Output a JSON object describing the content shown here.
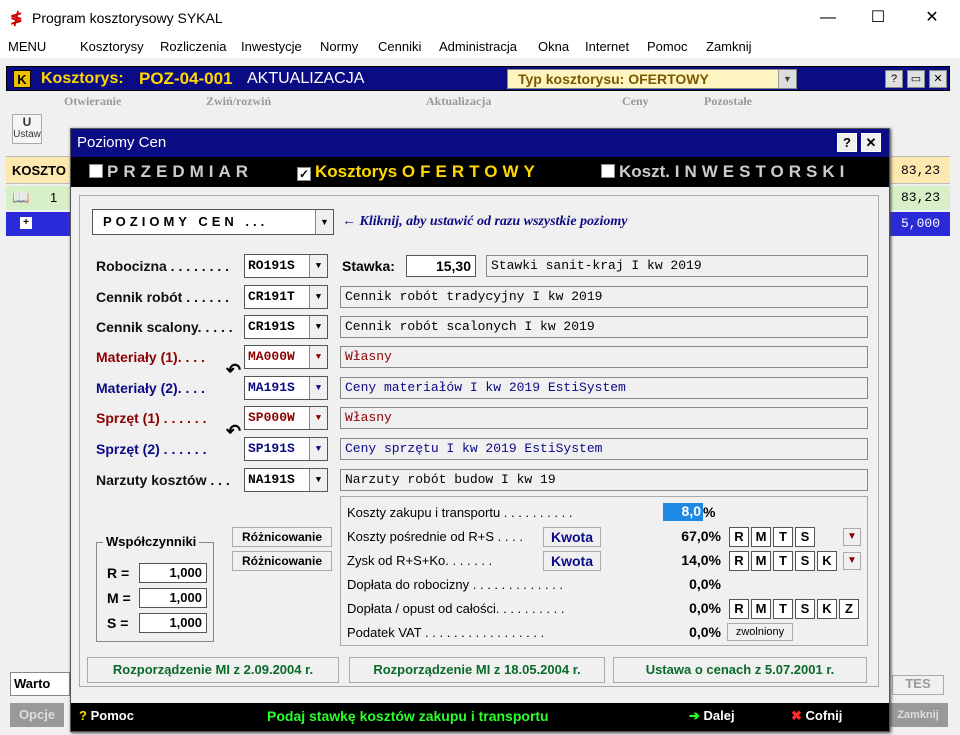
{
  "app": {
    "title": "Program kosztorysowy SYKAL",
    "min": "—",
    "max": "☐",
    "close": "✕"
  },
  "menu": [
    "MENU",
    "Kosztorysy",
    "Rozliczenia",
    "Inwestycje",
    "Normy",
    "Cenniki",
    "Administracja",
    "Okna",
    "Internet",
    "Pomoc",
    "Zamknij"
  ],
  "kbar": {
    "k": "K",
    "label": "Kosztorys:",
    "code": "POZ-04-001",
    "status": "AKTUALIZACJA",
    "typ": "Typ kosztorysu:  OFERTOWY"
  },
  "toolbar": {
    "groups": [
      "Otwieranie",
      "Zwiń/rozwiń",
      "Aktualizacja",
      "Ceny",
      "Pozostałe"
    ],
    "ustaw": "U",
    "ustaw_label": "Ustaw"
  },
  "bg": {
    "koszto": "KOSZTO",
    "sum1": "83,23",
    "row1_num": "1",
    "sum2": "83,23",
    "sum3": "5,000",
    "warto": "Warto",
    "tes": "TES",
    "opcje": "Opcje",
    "zamknij": "Zamknij"
  },
  "dialog": {
    "title": "Poziomy Cen",
    "help": "?",
    "close": "✕",
    "modes": {
      "m1": "PRZEDMIAR",
      "m2a": "Kosztorys",
      "m2b": "OFERTOWY",
      "m3a": "Koszt.",
      "m3b": "INWESTORSKI"
    },
    "poziomy": "POZIOMY CEN ...",
    "hint": "← Kliknij, aby ustawić od razu wszystkie poziomy",
    "stawka_label": "Stawka:",
    "stawka_value": "15,30",
    "stawka_desc": "Stawki sanit-kraj   I kw 2019",
    "rows": [
      {
        "label": "Robocizna . . . . . . . .",
        "code": "RO191S",
        "desc": ""
      },
      {
        "label": "Cennik robót . . . . . .",
        "code": "CR191T",
        "desc": "Cennik robót tradycyjny I kw 2019"
      },
      {
        "label": "Cennik scalony. . . . .",
        "code": "CR191S",
        "desc": "Cennik robót scalonych I kw 2019"
      },
      {
        "label": "Materiały (1). . . .",
        "code": "MA000W",
        "desc": "Własny"
      },
      {
        "label": "Materiały (2). . . .",
        "code": "MA191S",
        "desc": "Ceny materiałów I kw 2019 EstiSystem"
      },
      {
        "label": "Sprzęt (1) . . . . . .",
        "code": "SP000W",
        "desc": "Własny"
      },
      {
        "label": "Sprzęt (2) . . . . . .",
        "code": "SP191S",
        "desc": "Ceny sprzętu I kw 2019 EstiSystem"
      },
      {
        "label": "Narzuty kosztów . . .",
        "code": "NA191S",
        "desc": "Narzuty robót budow I kw 19"
      }
    ],
    "costs": [
      {
        "label": "Koszty zakupu i transportu . . . . . . . . . .",
        "value": "8,0",
        "pct": "%"
      },
      {
        "label": "Koszty pośrednie od R+S . . . .",
        "value": "67,0%"
      },
      {
        "label": "Zysk od R+S+Ko. . . . . . .",
        "value": "14,0%"
      },
      {
        "label": "Dopłata do robocizny . . . . . . . . . . . . .",
        "value": "0,0%"
      },
      {
        "label": "Dopłata / opust od całości. . . . . . . . . .",
        "value": "0,0%"
      },
      {
        "label": "Podatek VAT . . . . . . . . . . . . . . . . .",
        "value": "0,0%"
      }
    ],
    "kwota": "Kwota",
    "letters1": [
      "R",
      "M",
      "T",
      "S"
    ],
    "letters2": [
      "R",
      "M",
      "T",
      "S",
      "K"
    ],
    "letters3": [
      "R",
      "M",
      "T",
      "S",
      "K",
      "Z"
    ],
    "zwolniony": "zwolniony",
    "roznicowanie": "Różnicowanie",
    "wsp": {
      "title": "Współczynniki",
      "r": "R =",
      "m": "M =",
      "s": "S =",
      "rv": "1,000",
      "mv": "1,000",
      "sv": "1,000"
    },
    "regs": [
      "Rozporządzenie MI z 2.09.2004 r.",
      "Rozporządzenie MI z 18.05.2004 r.",
      "Ustawa o cenach z 5.07.2001 r."
    ],
    "status": {
      "q": "?",
      "pomoc": "Pomoc",
      "msg": "Podaj stawkę kosztów zakupu i transportu",
      "dalej": "Dalej",
      "cofnij": "Cofnij"
    }
  },
  "colors": {
    "navy": "#0b0b84",
    "red": "#8b0000",
    "green": "#0a6a2a",
    "yellow": "#ffd800"
  }
}
